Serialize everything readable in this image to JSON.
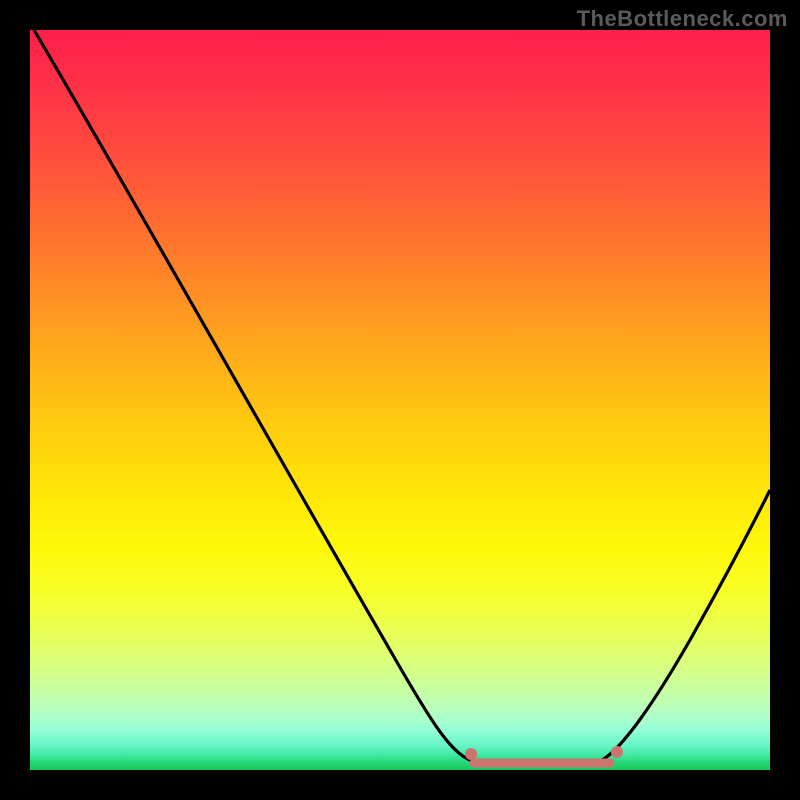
{
  "watermark": "TheBottleneck.com",
  "chart_data": {
    "type": "line",
    "title": "",
    "xlabel": "",
    "ylabel": "",
    "xlim": [
      0,
      100
    ],
    "ylim": [
      0,
      100
    ],
    "grid": false,
    "background_gradient": {
      "top_color": "#ff1f4b",
      "mid_color": "#ffe508",
      "bottom_color": "#18c85a"
    },
    "series": [
      {
        "name": "bottleneck-curve",
        "x": [
          0,
          5,
          10,
          15,
          20,
          25,
          30,
          35,
          40,
          45,
          50,
          55,
          58,
          60,
          63,
          66,
          70,
          74,
          78,
          80,
          83,
          86,
          90,
          94,
          98,
          100
        ],
        "y": [
          100,
          92,
          84,
          76,
          68,
          60,
          52,
          44,
          36,
          28,
          20,
          12,
          7,
          4,
          2,
          1,
          0.5,
          0.5,
          1,
          2,
          5,
          9,
          15,
          22,
          30,
          35
        ]
      }
    ],
    "markers": [
      {
        "name": "left-end-dot",
        "x": 58,
        "y": 3,
        "color": "#d67a73"
      },
      {
        "name": "right-end-dot",
        "x": 79,
        "y": 3,
        "color": "#d67a73"
      }
    ],
    "flat_segment": {
      "x_start": 60,
      "x_end": 78,
      "y": 0.7,
      "color": "#d67a73",
      "width": 6
    }
  }
}
